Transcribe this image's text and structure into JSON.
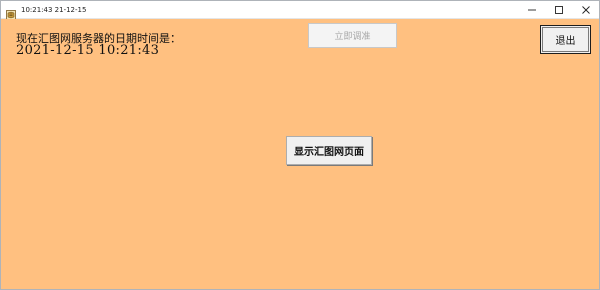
{
  "window": {
    "title": "10:21:43 21-12-15",
    "app_icon": "app-icon",
    "controls": {
      "minimize_icon": "minimize-icon",
      "maximize_icon": "maximize-icon",
      "close_icon": "close-icon"
    }
  },
  "main": {
    "server_time_label": "现在汇图网服务器的日期时间是：",
    "server_datetime": "2021-12-15  10:21:43",
    "disabled_button_label": "立即调准",
    "exit_button_label": "退出",
    "show_page_button_label": "显示汇图网页面"
  },
  "colors": {
    "client_background": "#ffc080",
    "button_face": "#f0f0f0",
    "disabled_text": "#a9a9a9"
  }
}
